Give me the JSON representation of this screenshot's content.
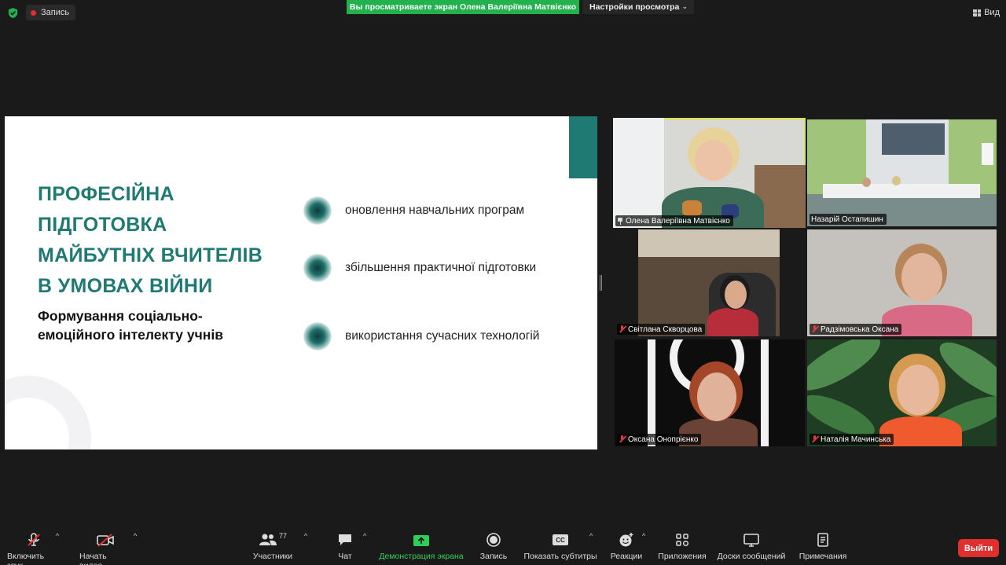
{
  "top": {
    "record_label": "Запись",
    "share_banner": "Вы просматриваете экран Олена Валеріївна Матвієнко",
    "view_settings": "Настройки просмотра",
    "view_label": "Вид"
  },
  "slide": {
    "title_lines": [
      "ПРОФЕСІЙНА",
      "ПІДГОТОВКА",
      "МАЙБУТНІХ ВЧИТЕЛІВ",
      "В УМОВАХ ВІЙНИ"
    ],
    "subtitle_lines": [
      "Формування соціально-",
      "емоційного інтелекту учнів"
    ],
    "bullets": [
      "оновлення навчальних програм",
      "збільшення практичної підготовки",
      "використання сучасних технологій"
    ],
    "colors": {
      "accent": "#1e7a72"
    }
  },
  "participants": [
    {
      "name": "Олена Валеріївна Матвієнко",
      "status": "pinned",
      "active_speaker": true
    },
    {
      "name": "Назарій Остапишин",
      "status": "none",
      "active_speaker": false
    },
    {
      "name": "Світлана Скворцова",
      "status": "muted",
      "active_speaker": false
    },
    {
      "name": "Радзімовська Оксана",
      "status": "muted",
      "active_speaker": false
    },
    {
      "name": "Оксана Онопрієнко",
      "status": "muted",
      "active_speaker": false
    },
    {
      "name": "Наталія Мачинська",
      "status": "muted",
      "active_speaker": false
    }
  ],
  "toolbar": {
    "audio": "Включить звук",
    "video": "Начать видео",
    "participants": "Участники",
    "participants_count": "77",
    "chat": "Чат",
    "share": "Демонстрация экрана",
    "record": "Запись",
    "captions": "Показать субтитры",
    "captions_icon_text": "CC",
    "reactions": "Реакции",
    "apps": "Приложения",
    "whiteboards": "Доски сообщений",
    "notes": "Примечания",
    "leave": "Выйти"
  }
}
